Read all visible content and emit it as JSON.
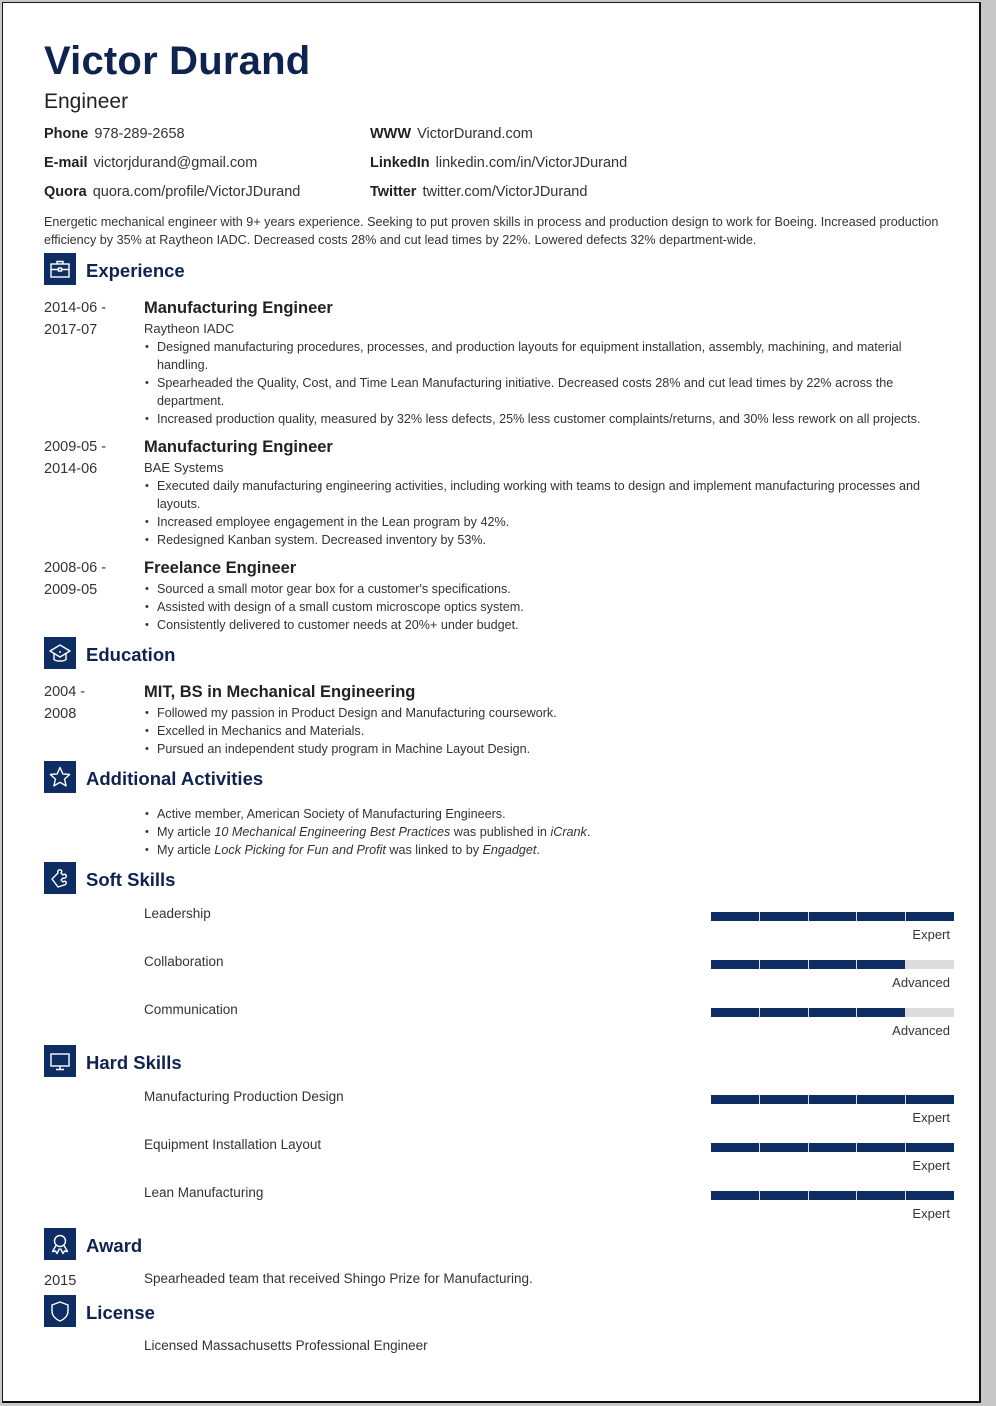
{
  "header": {
    "name": "Victor Durand",
    "title": "Engineer"
  },
  "contacts": [
    {
      "label": "Phone",
      "value": "978-289-2658"
    },
    {
      "label": "E-mail",
      "value": "victorjdurand@gmail.com"
    },
    {
      "label": "Quora",
      "value": "quora.com/profile/VictorJDurand"
    },
    {
      "label": "WWW",
      "value": "VictorDurand.com"
    },
    {
      "label": "LinkedIn",
      "value": "linkedin.com/in/VictorJDurand"
    },
    {
      "label": "Twitter",
      "value": "twitter.com/VictorJDurand"
    }
  ],
  "summary": "Energetic mechanical engineer with 9+ years experience. Seeking to put proven skills in process and production design to work for Boeing. Increased production efficiency by 35% at Raytheon IADC. Decreased costs 28% and cut lead times by 22%. Lowered defects 32% department-wide.",
  "experience": {
    "heading": "Experience",
    "icon": "briefcase-icon",
    "jobs": [
      {
        "date_start": "2014-06 -",
        "date_end": "2017-07",
        "title": "Manufacturing Engineer",
        "company": "Raytheon IADC",
        "bullets": [
          "Designed manufacturing procedures, processes, and production layouts for equipment installation, assembly, machining, and material handling.",
          "Spearheaded the Quality, Cost, and Time Lean Manufacturing initiative. Decreased costs 28% and cut lead times by 22% across the department.",
          "Increased production quality, measured by 32% less defects, 25% less customer complaints/returns, and 30% less rework on all projects."
        ]
      },
      {
        "date_start": "2009-05 -",
        "date_end": "2014-06",
        "title": "Manufacturing Engineer",
        "company": "BAE Systems",
        "bullets": [
          "Executed daily manufacturing engineering activities, including working with teams to design and implement manufacturing processes and layouts.",
          "Increased employee engagement in the Lean program by 42%.",
          "Redesigned Kanban system. Decreased inventory by 53%."
        ]
      },
      {
        "date_start": "2008-06 -",
        "date_end": "2009-05",
        "title": "Freelance Engineer",
        "company": "",
        "bullets": [
          "Sourced a small motor gear box for a customer's specifications.",
          "Assisted with design of a small custom microscope optics system.",
          "Consistently delivered to customer needs at 20%+ under budget."
        ]
      }
    ]
  },
  "education": {
    "heading": "Education",
    "icon": "graduation-cap-icon",
    "entries": [
      {
        "date_start": "2004 -",
        "date_end": "2008",
        "title": "MIT, BS in Mechanical Engineering",
        "bullets": [
          "Followed my passion in Product Design and Manufacturing coursework.",
          "Excelled in Mechanics and Materials.",
          "Pursued an independent study program in Machine Layout Design."
        ]
      }
    ]
  },
  "activities": {
    "heading": "Additional Activities",
    "icon": "star-icon",
    "items": [
      {
        "parts": [
          {
            "t": "Active member, American Society of Manufacturing Engineers.",
            "i": false
          }
        ]
      },
      {
        "parts": [
          {
            "t": "My article ",
            "i": false
          },
          {
            "t": "10 Mechanical Engineering Best Practices",
            "i": true
          },
          {
            "t": " was published in ",
            "i": false
          },
          {
            "t": "iCrank",
            "i": true
          },
          {
            "t": ".",
            "i": false
          }
        ]
      },
      {
        "parts": [
          {
            "t": "My article ",
            "i": false
          },
          {
            "t": "Lock Picking for Fun and Profit",
            "i": true
          },
          {
            "t": " was linked to by ",
            "i": false
          },
          {
            "t": "Engadget",
            "i": true
          },
          {
            "t": ".",
            "i": false
          }
        ]
      }
    ]
  },
  "soft_skills": {
    "heading": "Soft Skills",
    "icon": "puzzle-piece-icon",
    "items": [
      {
        "name": "Leadership",
        "level": "Expert",
        "rating": 5,
        "max": 5
      },
      {
        "name": "Collaboration",
        "level": "Advanced",
        "rating": 4,
        "max": 5
      },
      {
        "name": "Communication",
        "level": "Advanced",
        "rating": 4,
        "max": 5
      }
    ]
  },
  "hard_skills": {
    "heading": "Hard Skills",
    "icon": "monitor-icon",
    "items": [
      {
        "name": "Manufacturing Production Design",
        "level": "Expert",
        "rating": 5,
        "max": 5
      },
      {
        "name": "Equipment Installation Layout",
        "level": "Expert",
        "rating": 5,
        "max": 5
      },
      {
        "name": "Lean Manufacturing",
        "level": "Expert",
        "rating": 5,
        "max": 5
      }
    ]
  },
  "award": {
    "heading": "Award",
    "icon": "award-ribbon-icon",
    "year": "2015",
    "text": "Spearheaded team that received Shingo Prize for Manufacturing."
  },
  "license": {
    "heading": "License",
    "icon": "shield-icon",
    "text": "Licensed Massachusetts Professional Engineer"
  },
  "colors": {
    "accent": "#0e2d63",
    "heading_text": "#0e2350",
    "bar_empty": "#dcdcdc"
  }
}
